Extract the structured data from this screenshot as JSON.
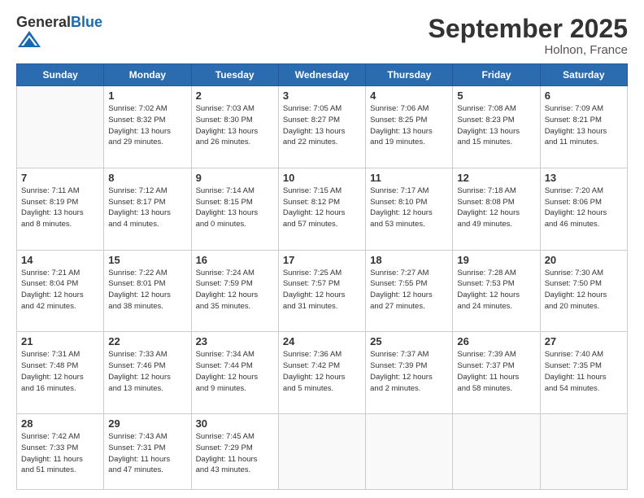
{
  "logo": {
    "general": "General",
    "blue": "Blue"
  },
  "header": {
    "month": "September 2025",
    "location": "Holnon, France"
  },
  "weekdays": [
    "Sunday",
    "Monday",
    "Tuesday",
    "Wednesday",
    "Thursday",
    "Friday",
    "Saturday"
  ],
  "weeks": [
    [
      {
        "day": "",
        "info": ""
      },
      {
        "day": "1",
        "info": "Sunrise: 7:02 AM\nSunset: 8:32 PM\nDaylight: 13 hours\nand 29 minutes."
      },
      {
        "day": "2",
        "info": "Sunrise: 7:03 AM\nSunset: 8:30 PM\nDaylight: 13 hours\nand 26 minutes."
      },
      {
        "day": "3",
        "info": "Sunrise: 7:05 AM\nSunset: 8:27 PM\nDaylight: 13 hours\nand 22 minutes."
      },
      {
        "day": "4",
        "info": "Sunrise: 7:06 AM\nSunset: 8:25 PM\nDaylight: 13 hours\nand 19 minutes."
      },
      {
        "day": "5",
        "info": "Sunrise: 7:08 AM\nSunset: 8:23 PM\nDaylight: 13 hours\nand 15 minutes."
      },
      {
        "day": "6",
        "info": "Sunrise: 7:09 AM\nSunset: 8:21 PM\nDaylight: 13 hours\nand 11 minutes."
      }
    ],
    [
      {
        "day": "7",
        "info": "Sunrise: 7:11 AM\nSunset: 8:19 PM\nDaylight: 13 hours\nand 8 minutes."
      },
      {
        "day": "8",
        "info": "Sunrise: 7:12 AM\nSunset: 8:17 PM\nDaylight: 13 hours\nand 4 minutes."
      },
      {
        "day": "9",
        "info": "Sunrise: 7:14 AM\nSunset: 8:15 PM\nDaylight: 13 hours\nand 0 minutes."
      },
      {
        "day": "10",
        "info": "Sunrise: 7:15 AM\nSunset: 8:12 PM\nDaylight: 12 hours\nand 57 minutes."
      },
      {
        "day": "11",
        "info": "Sunrise: 7:17 AM\nSunset: 8:10 PM\nDaylight: 12 hours\nand 53 minutes."
      },
      {
        "day": "12",
        "info": "Sunrise: 7:18 AM\nSunset: 8:08 PM\nDaylight: 12 hours\nand 49 minutes."
      },
      {
        "day": "13",
        "info": "Sunrise: 7:20 AM\nSunset: 8:06 PM\nDaylight: 12 hours\nand 46 minutes."
      }
    ],
    [
      {
        "day": "14",
        "info": "Sunrise: 7:21 AM\nSunset: 8:04 PM\nDaylight: 12 hours\nand 42 minutes."
      },
      {
        "day": "15",
        "info": "Sunrise: 7:22 AM\nSunset: 8:01 PM\nDaylight: 12 hours\nand 38 minutes."
      },
      {
        "day": "16",
        "info": "Sunrise: 7:24 AM\nSunset: 7:59 PM\nDaylight: 12 hours\nand 35 minutes."
      },
      {
        "day": "17",
        "info": "Sunrise: 7:25 AM\nSunset: 7:57 PM\nDaylight: 12 hours\nand 31 minutes."
      },
      {
        "day": "18",
        "info": "Sunrise: 7:27 AM\nSunset: 7:55 PM\nDaylight: 12 hours\nand 27 minutes."
      },
      {
        "day": "19",
        "info": "Sunrise: 7:28 AM\nSunset: 7:53 PM\nDaylight: 12 hours\nand 24 minutes."
      },
      {
        "day": "20",
        "info": "Sunrise: 7:30 AM\nSunset: 7:50 PM\nDaylight: 12 hours\nand 20 minutes."
      }
    ],
    [
      {
        "day": "21",
        "info": "Sunrise: 7:31 AM\nSunset: 7:48 PM\nDaylight: 12 hours\nand 16 minutes."
      },
      {
        "day": "22",
        "info": "Sunrise: 7:33 AM\nSunset: 7:46 PM\nDaylight: 12 hours\nand 13 minutes."
      },
      {
        "day": "23",
        "info": "Sunrise: 7:34 AM\nSunset: 7:44 PM\nDaylight: 12 hours\nand 9 minutes."
      },
      {
        "day": "24",
        "info": "Sunrise: 7:36 AM\nSunset: 7:42 PM\nDaylight: 12 hours\nand 5 minutes."
      },
      {
        "day": "25",
        "info": "Sunrise: 7:37 AM\nSunset: 7:39 PM\nDaylight: 12 hours\nand 2 minutes."
      },
      {
        "day": "26",
        "info": "Sunrise: 7:39 AM\nSunset: 7:37 PM\nDaylight: 11 hours\nand 58 minutes."
      },
      {
        "day": "27",
        "info": "Sunrise: 7:40 AM\nSunset: 7:35 PM\nDaylight: 11 hours\nand 54 minutes."
      }
    ],
    [
      {
        "day": "28",
        "info": "Sunrise: 7:42 AM\nSunset: 7:33 PM\nDaylight: 11 hours\nand 51 minutes."
      },
      {
        "day": "29",
        "info": "Sunrise: 7:43 AM\nSunset: 7:31 PM\nDaylight: 11 hours\nand 47 minutes."
      },
      {
        "day": "30",
        "info": "Sunrise: 7:45 AM\nSunset: 7:29 PM\nDaylight: 11 hours\nand 43 minutes."
      },
      {
        "day": "",
        "info": ""
      },
      {
        "day": "",
        "info": ""
      },
      {
        "day": "",
        "info": ""
      },
      {
        "day": "",
        "info": ""
      }
    ]
  ]
}
